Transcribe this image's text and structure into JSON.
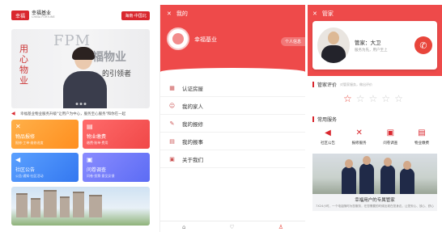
{
  "phone1": {
    "logo_mark": "幸福",
    "logo_title": "幸福基业",
    "logo_subtitle": "CHINA FORTUNE",
    "location_button": "海南·中国北",
    "banner": {
      "fpm": "FPM",
      "brand": "幸福物业",
      "vertical": [
        "用",
        "心",
        "物",
        "业"
      ],
      "slogan": "的引领者"
    },
    "notice": "幸福基业物业服务升级\"让用户为中心，服务至心服务\"和你在一起",
    "tiles": [
      {
        "title": "物品报修",
        "sub": "报修·工单·维修进度"
      },
      {
        "title": "物业缴费",
        "sub": "缴费·账单·费用"
      },
      {
        "title": "社区公告",
        "sub": "公告·通知·社区活动"
      },
      {
        "title": "问卷调查",
        "sub": "问卷·投票·意见反馈"
      }
    ]
  },
  "phone2": {
    "header_title": "我的",
    "user_name": "幸福基业",
    "personal_info": "个人信息",
    "menu": [
      "认证房屋",
      "我的家人",
      "我的报修",
      "我的报事",
      "关于我们"
    ]
  },
  "phone3": {
    "header_title": "管家",
    "manager_name": "管家：大卫",
    "manager_sub": "服务为先，用户至上",
    "rating_title": "管家评价",
    "rating_hint": "对管家服务，做出评价",
    "rating": 1,
    "rating_max": 5,
    "services_title": "常用服务",
    "services": [
      "社区公告",
      "报修服务",
      "问卷调查",
      "物业缴费"
    ],
    "caption_title": "幸福用户的专属管家",
    "caption_text": "7X24小时，一个电话随时为您服务，在您需要的时候出现在您身边，让您安心、放心、舒心"
  }
}
